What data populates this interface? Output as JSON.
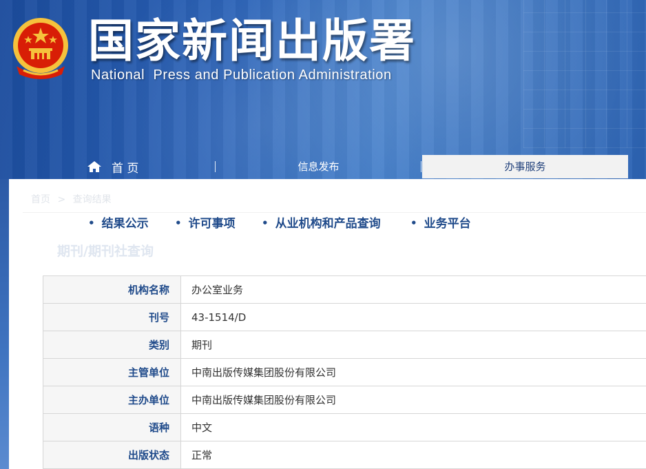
{
  "header": {
    "title_cn": "国家新闻出版署",
    "title_en": "National  Press and Publication Administration"
  },
  "nav": {
    "home_label": "首 页",
    "items": [
      {
        "label": "信息发布",
        "active": false
      },
      {
        "label": "办事服务",
        "active": true
      }
    ]
  },
  "breadcrumb": [
    "首页",
    ">",
    "查询结果"
  ],
  "subnav": [
    "结果公示",
    "许可事项",
    "从业机构和产品查询",
    "业务平台"
  ],
  "section_title": "期刊/期刊社查询",
  "table": [
    {
      "key": "机构名称",
      "value": "办公室业务"
    },
    {
      "key": "刊号",
      "value": "43-1514/D"
    },
    {
      "key": "类别",
      "value": "期刊"
    },
    {
      "key": "主管单位",
      "value": "中南出版传媒集团股份有限公司"
    },
    {
      "key": "主办单位",
      "value": "中南出版传媒集团股份有限公司"
    },
    {
      "key": "语种",
      "value": "中文"
    },
    {
      "key": "出版状态",
      "value": "正常"
    }
  ],
  "colors": {
    "brand_blue": "#2a62b7",
    "label_blue": "#1f4a8a",
    "emblem_red": "#d81e06",
    "emblem_gold": "#f6c23c"
  },
  "icons": {
    "home": "home-icon",
    "emblem": "national-emblem-icon",
    "bullet": "bullet-dot"
  }
}
